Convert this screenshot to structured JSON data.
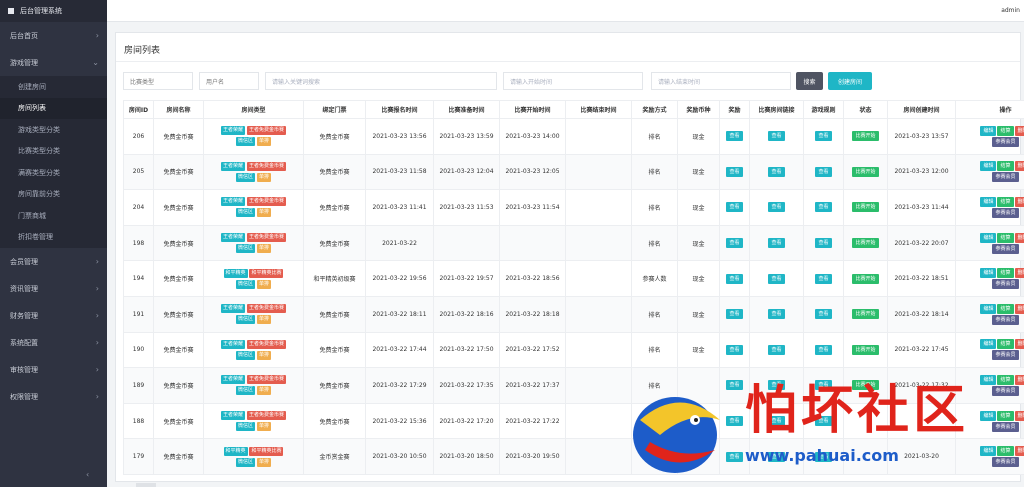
{
  "app": {
    "title": "后台管理系统",
    "user": "admin"
  },
  "sidebar": {
    "items": [
      {
        "label": "后台首页"
      },
      {
        "label": "游戏管理",
        "expanded": true,
        "children": [
          {
            "label": "创建房间"
          },
          {
            "label": "房间列表",
            "active": true
          },
          {
            "label": "游戏类型分类"
          },
          {
            "label": "比赛类型分类"
          },
          {
            "label": "满赛类型分类"
          },
          {
            "label": "房间靠前分类"
          },
          {
            "label": "门票商城"
          },
          {
            "label": "折扣卷管理"
          }
        ]
      },
      {
        "label": "会员管理"
      },
      {
        "label": "资讯管理"
      },
      {
        "label": "财务管理"
      },
      {
        "label": "系统配置"
      },
      {
        "label": "审核管理"
      },
      {
        "label": "权限管理"
      }
    ],
    "collapse_icon": "‹"
  },
  "page": {
    "title": "房间列表"
  },
  "filters": {
    "match_type": "比赛类型",
    "username": "用户名",
    "keyword_placeholder": "请输入关键词搜索",
    "start_placeholder": "请输入开始时间",
    "end_placeholder": "请输入结束时间",
    "search_label": "搜索",
    "create_label": "创建房间"
  },
  "table": {
    "headers": [
      "房间ID",
      "房间名称",
      "房间类型",
      "绑定门票",
      "比赛报名时间",
      "比赛准备时间",
      "比赛开始时间",
      "比赛结束时间",
      "奖励方式",
      "奖励币种",
      "奖励",
      "比赛房间链接",
      "游戏规则",
      "状态",
      "房间创建时间",
      "操作"
    ],
    "action_labels": {
      "view": "查看",
      "edit": "编辑",
      "settle": "结算",
      "delete": "删除",
      "members": "参赛会员"
    },
    "rows": [
      {
        "id": "206",
        "name": "免费金币赛",
        "types": [
          "王者荣耀",
          "王者免费金币赛",
          "微信区",
          "单排"
        ],
        "ticket": "免费金币赛",
        "signup": "2021-03-23 13:56",
        "ready": "2021-03-23 13:59",
        "start": "2021-03-23 14:00",
        "end": "",
        "reward_mode": "排名",
        "currency": "现金",
        "status": "比赛开始",
        "created": "2021-03-23 13:57"
      },
      {
        "id": "205",
        "name": "免费金币赛",
        "types": [
          "王者荣耀",
          "王者免费金币赛",
          "微信区",
          "单排"
        ],
        "ticket": "免费金币赛",
        "signup": "2021-03-23 11:58",
        "ready": "2021-03-23 12:04",
        "start": "2021-03-23 12:05",
        "end": "",
        "reward_mode": "排名",
        "currency": "现金",
        "status": "比赛开始",
        "created": "2021-03-23 12:00"
      },
      {
        "id": "204",
        "name": "免费金币赛",
        "types": [
          "王者荣耀",
          "王者免费金币赛",
          "微信区",
          "单排"
        ],
        "ticket": "免费金币赛",
        "signup": "2021-03-23 11:41",
        "ready": "2021-03-23 11:53",
        "start": "2021-03-23 11:54",
        "end": "",
        "reward_mode": "排名",
        "currency": "现金",
        "status": "比赛开始",
        "created": "2021-03-23 11:44"
      },
      {
        "id": "198",
        "name": "免费金币赛",
        "types": [
          "王者荣耀",
          "王者免费金币赛",
          "微信区",
          "单排"
        ],
        "ticket": "免费金币赛",
        "signup": "2021-03-22",
        "ready": "",
        "start": "",
        "end": "",
        "reward_mode": "排名",
        "currency": "现金",
        "status": "比赛开始",
        "created": "2021-03-22 20:07"
      },
      {
        "id": "194",
        "name": "免费金币赛",
        "types": [
          "和平精英",
          "和平精英比赛",
          "微信区",
          "单排"
        ],
        "ticket": "和平精英初级赛",
        "signup": "2021-03-22 19:56",
        "ready": "2021-03-22 19:57",
        "start": "2021-03-22 18:56",
        "end": "",
        "reward_mode": "参赛人数",
        "currency": "现金",
        "status": "比赛开始",
        "created": "2021-03-22 18:51"
      },
      {
        "id": "191",
        "name": "免费金币赛",
        "types": [
          "王者荣耀",
          "王者免费金币赛",
          "微信区",
          "单排"
        ],
        "ticket": "免费金币赛",
        "signup": "2021-03-22 18:11",
        "ready": "2021-03-22 18:16",
        "start": "2021-03-22 18:18",
        "end": "",
        "reward_mode": "排名",
        "currency": "现金",
        "status": "比赛开始",
        "created": "2021-03-22 18:14"
      },
      {
        "id": "190",
        "name": "免费金币赛",
        "types": [
          "王者荣耀",
          "王者免费金币赛",
          "微信区",
          "单排"
        ],
        "ticket": "免费金币赛",
        "signup": "2021-03-22 17:44",
        "ready": "2021-03-22 17:50",
        "start": "2021-03-22 17:52",
        "end": "",
        "reward_mode": "排名",
        "currency": "现金",
        "status": "比赛开始",
        "created": "2021-03-22 17:45"
      },
      {
        "id": "189",
        "name": "免费金币赛",
        "types": [
          "王者荣耀",
          "王者免费金币赛",
          "微信区",
          "单排"
        ],
        "ticket": "免费金币赛",
        "signup": "2021-03-22 17:29",
        "ready": "2021-03-22 17:35",
        "start": "2021-03-22 17:37",
        "end": "",
        "reward_mode": "排名",
        "currency": "",
        "status": "比赛开始",
        "created": "2021-03-22 17:32"
      },
      {
        "id": "188",
        "name": "免费金币赛",
        "types": [
          "王者荣耀",
          "王者免费金币赛",
          "微信区",
          "单排"
        ],
        "ticket": "免费金币赛",
        "signup": "2021-03-22 15:36",
        "ready": "2021-03-22 17:20",
        "start": "2021-03-22 17:22",
        "end": "",
        "reward_mode": "排名",
        "currency": "",
        "status": "",
        "created": ""
      },
      {
        "id": "179",
        "name": "免费金币赛",
        "types": [
          "和平精英",
          "和平精英比赛",
          "微信区",
          "单排"
        ],
        "ticket": "金币赏金赛",
        "signup": "2021-03-20 10:50",
        "ready": "2021-03-20 18:50",
        "start": "2021-03-20 19:50",
        "end": "",
        "reward_mode": "",
        "currency": "",
        "status": "",
        "created": "2021-03-20"
      }
    ]
  },
  "watermark": {
    "text": "怕坏社区",
    "url": "www.pahuai.com"
  },
  "colors": {
    "sidebar": "#2f3341",
    "accent": "#1fb6c6",
    "danger": "#e45c4e",
    "success": "#2bbd6b",
    "warning": "#f0ad4e"
  }
}
